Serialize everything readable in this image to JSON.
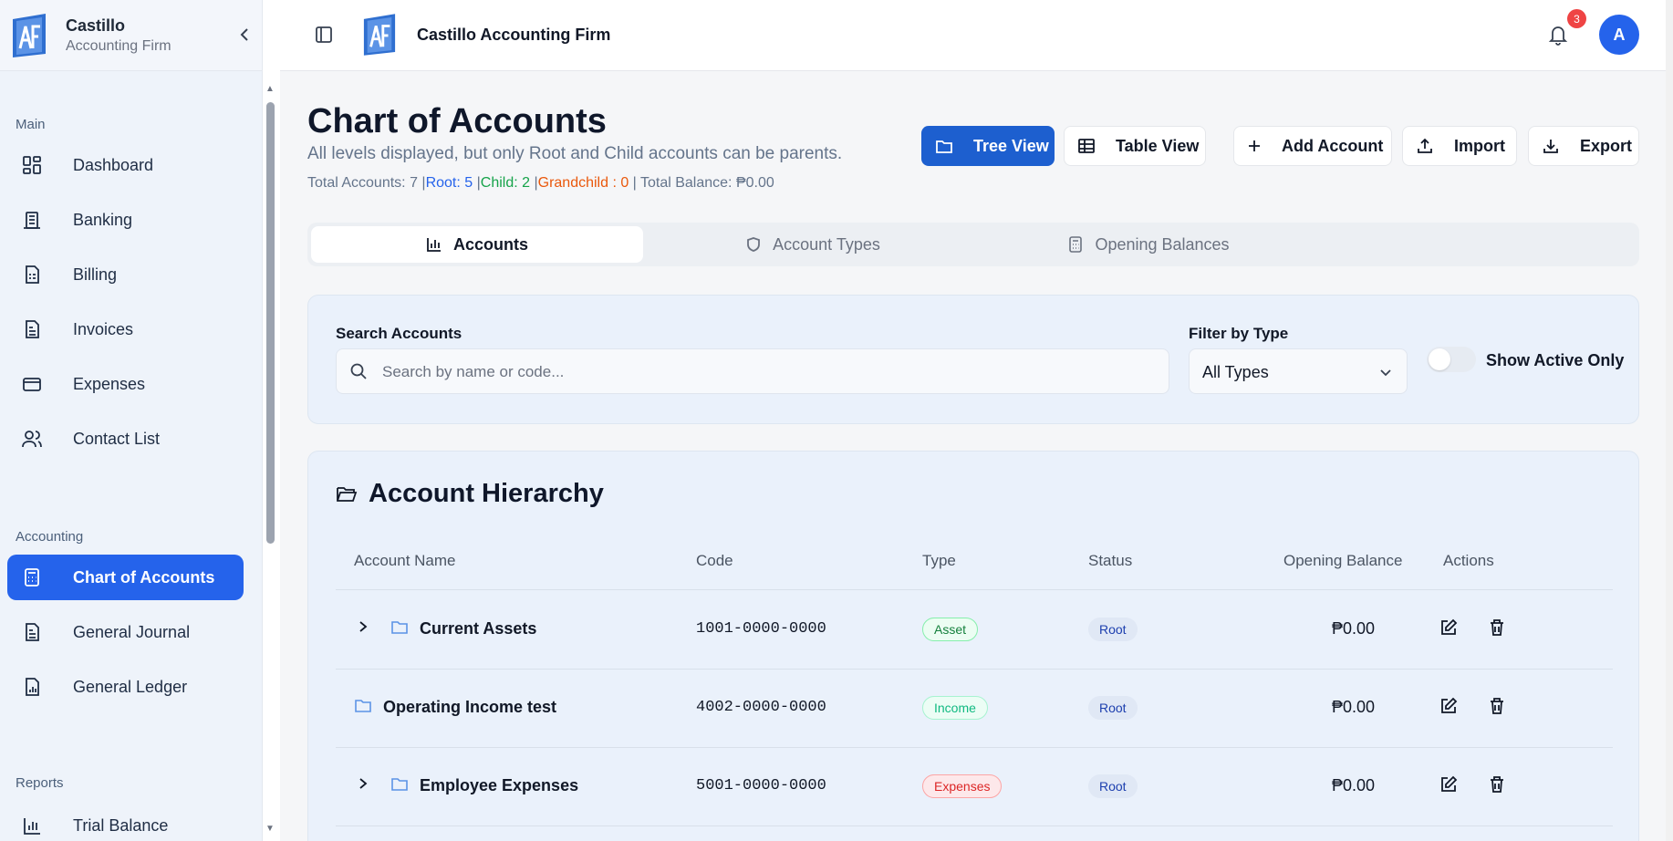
{
  "sidebar": {
    "brand_name": "Castillo",
    "brand_sub": "Accounting Firm",
    "sections": {
      "main": "Main",
      "accounting": "Accounting",
      "reports": "Reports"
    },
    "main_items": [
      {
        "label": "Dashboard",
        "icon": "dashboard-icon"
      },
      {
        "label": "Banking",
        "icon": "bank-icon"
      },
      {
        "label": "Billing",
        "icon": "billing-icon"
      },
      {
        "label": "Invoices",
        "icon": "invoice-icon"
      },
      {
        "label": "Expenses",
        "icon": "credit-card-icon"
      },
      {
        "label": "Contact List",
        "icon": "users-icon"
      }
    ],
    "accounting_items": [
      {
        "label": "Chart of Accounts",
        "icon": "calculator-icon",
        "active": true
      },
      {
        "label": "General Journal",
        "icon": "journal-icon"
      },
      {
        "label": "General Ledger",
        "icon": "ledger-icon"
      }
    ],
    "reports_items": [
      {
        "label": "Trial Balance",
        "icon": "bar-chart-icon"
      }
    ]
  },
  "topbar": {
    "title": "Castillo Accounting Firm",
    "notification_count": "3",
    "avatar_initial": "A"
  },
  "page": {
    "title": "Chart of Accounts",
    "subtitle": "All levels displayed, but only Root and Child accounts can be parents.",
    "stats": {
      "total": "Total Accounts: 7 |",
      "root": "Root: 5",
      "sep1": " |",
      "child": "Child: 2",
      "sep2": " |",
      "grandchild": "Grandchild : 0",
      "balance": " | Total Balance: ₱0.00"
    },
    "buttons": {
      "tree_view": "Tree View",
      "table_view": "Table View",
      "add_account": "Add Account",
      "import": "Import",
      "export": "Export"
    },
    "tabs": [
      {
        "label": "Accounts",
        "active": true
      },
      {
        "label": "Account Types"
      },
      {
        "label": "Opening Balances"
      }
    ],
    "filters": {
      "search_label": "Search Accounts",
      "search_placeholder": "Search by name or code...",
      "type_label": "Filter by Type",
      "type_value": "All Types",
      "toggle_label": "Show Active Only"
    },
    "hierarchy": {
      "title": "Account Hierarchy",
      "columns": [
        "Account Name",
        "Code",
        "Type",
        "Status",
        "Opening Balance",
        "Actions"
      ],
      "rows": [
        {
          "name": "Current Assets",
          "code": "1001-0000-0000",
          "type": "Asset",
          "status": "Root",
          "balance": "₱0.00",
          "expandable": true
        },
        {
          "name": "Operating Income test",
          "code": "4002-0000-0000",
          "type": "Income",
          "status": "Root",
          "balance": "₱0.00",
          "expandable": false
        },
        {
          "name": "Employee Expenses",
          "code": "5001-0000-0000",
          "type": "Expenses",
          "status": "Root",
          "balance": "₱0.00",
          "expandable": true
        }
      ]
    }
  },
  "colors": {
    "primary": "#2563eb",
    "root_stat": "#2563eb",
    "child_stat": "#16a34a",
    "grandchild_stat": "#ea580c"
  }
}
